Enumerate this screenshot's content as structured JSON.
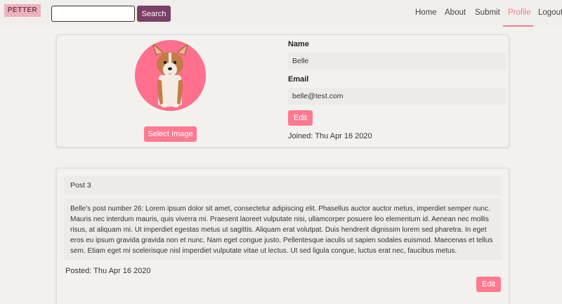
{
  "navbar": {
    "logo_text": "PETTER",
    "search": {
      "value": "",
      "placeholder": ""
    },
    "search_button_label": "Search",
    "links": {
      "home": "Home",
      "about": "About",
      "submit": "Submit",
      "profile": "Profile",
      "logout": "Logout"
    },
    "active_link": "Profile",
    "accent_color": "#f07d8f"
  },
  "profile": {
    "select_image_label": "Select Image",
    "name_label": "Name",
    "name_value": "Belle",
    "email_label": "Email",
    "email_value": "belle@test.com",
    "edit_label": "Edit",
    "joined_text": "Joined: Thu Apr 16 2020"
  },
  "post": {
    "title": "Post 3",
    "body": "Belle's post number 26: Lorem ipsum dolor sit amet, consectetur adipiscing elit. Phasellus auctor auctor metus, imperdiet semper nunc. Mauris nec interdum mauris, quis viverra mi. Praesent laoreet vulputate nisi, ullamcorper posuere leo elementum id. Aenean nec mollis risus, at aliquam mi. Ut imperdiet egestas metus ut sagittis. Aliquam erat volutpat. Duis hendrerit dignissim lorem sed pharetra. In eget eros eu ipsum gravida gravida non et nunc. Nam eget congue justo. Pellentesque iaculis ut sapien sodales euismod. Maecenas et tellus sem. Etiam eget mi scelerisque nisl imperdiet vulputate vitae ut lectus. Ut sed ligula congue, luctus erat nec, faucibus metus.",
    "posted_text": "Posted: Thu Apr 16 2020",
    "edit_label": "Edit"
  },
  "colors": {
    "button_pink": "#ff7991",
    "search_button": "#7c3f65",
    "background": "#f2f1ee"
  }
}
